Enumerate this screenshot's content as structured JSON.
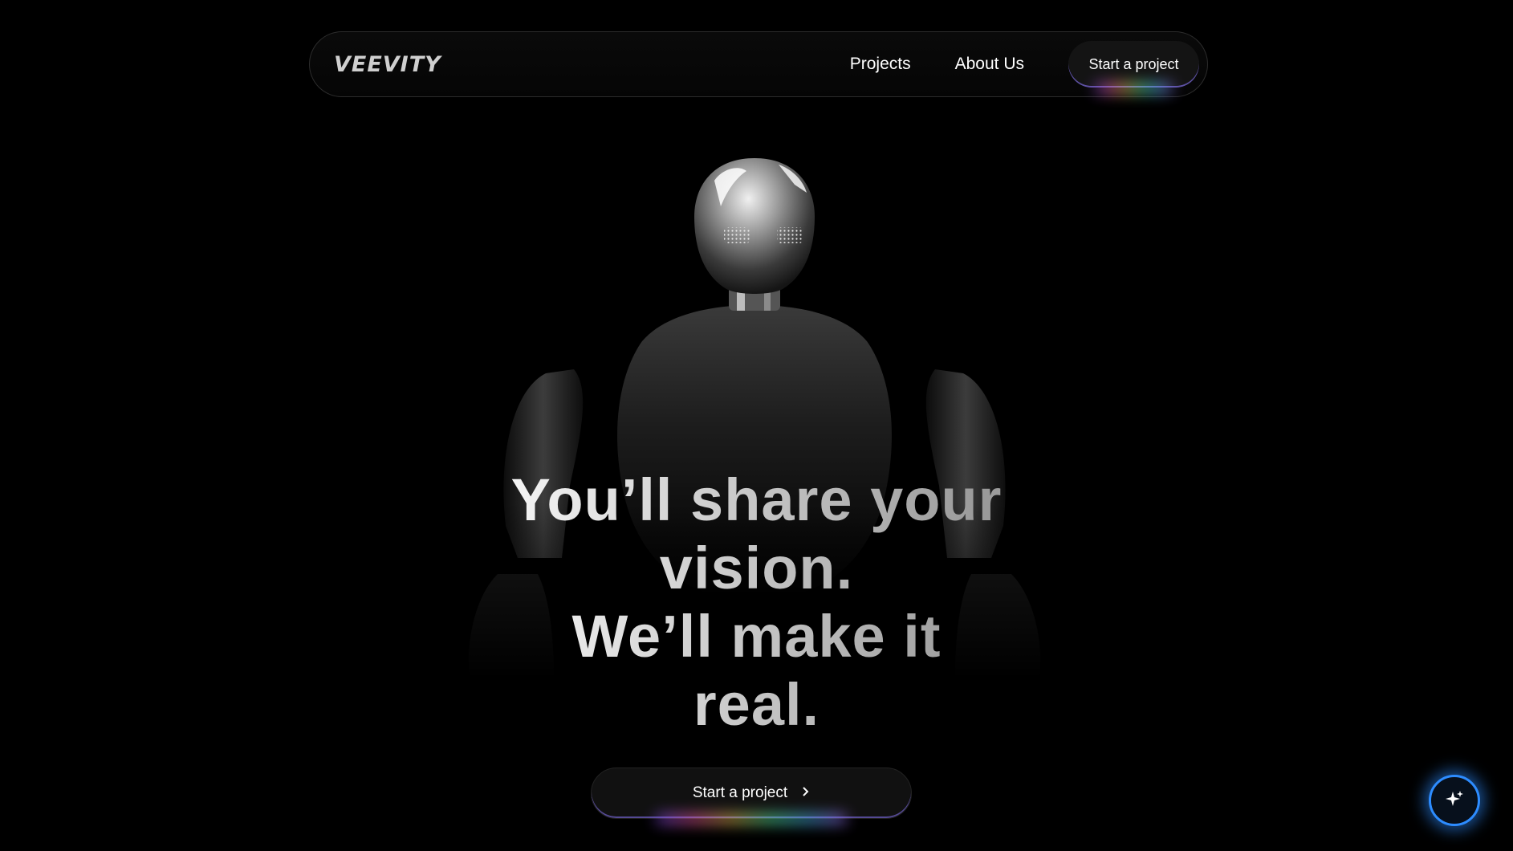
{
  "nav": {
    "logo": "VEEVITY",
    "links": [
      "Projects",
      "About Us"
    ],
    "cta": "Start a project"
  },
  "hero": {
    "title_lines": [
      "You’ll share your",
      "vision.",
      "We’ll make it",
      "real."
    ],
    "cta": "Start a project",
    "cta_icon": "chevron-right-icon"
  },
  "fab": {
    "icon": "sparkle-icon"
  },
  "colors": {
    "background": "#000000",
    "accent_glow": "#2d8cff",
    "button_bg": "#141414"
  }
}
